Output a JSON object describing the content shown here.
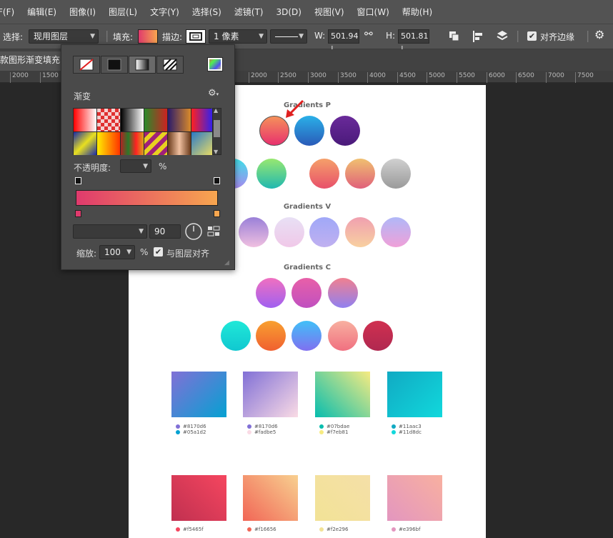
{
  "menubar": {
    "items": [
      "F(F)",
      "编辑(E)",
      "图像(I)",
      "图层(L)",
      "文字(Y)",
      "选择(S)",
      "滤镜(T)",
      "3D(D)",
      "视图(V)",
      "窗口(W)",
      "帮助(H)"
    ]
  },
  "options": {
    "select_label": "选择:",
    "select_value": "现用图层",
    "fill_label": "填充:",
    "stroke_label": "描边:",
    "stroke_width": "1 像素",
    "w_label": "W:",
    "w_value": "501.94 |",
    "h_label": "H:",
    "h_value": "501.81 |",
    "align_edges_label": "对齐边缘"
  },
  "tab": {
    "title": "款图形渐变填充"
  },
  "ruler": {
    "marks": [
      "2000",
      "1500",
      "2000",
      "2500",
      "3000",
      "3500",
      "4000",
      "4500",
      "5000",
      "5500",
      "6000",
      "6500",
      "7000",
      "7500"
    ]
  },
  "panel": {
    "gradient_label": "渐变",
    "opacity_label": "不透明度:",
    "opacity_unit": "%",
    "angle_value": "90",
    "scale_label": "缩放:",
    "scale_value": "100",
    "scale_unit": "%",
    "align_layer_label": "与图层对齐",
    "swatches": [
      "linear-gradient(90deg,#ff0000,#ffffff)",
      "repeating-conic-gradient(#e03030 0 25%,#f5d0d0 0 50%) 0 0/10px 10px",
      "linear-gradient(90deg,#000000,#ffffff)",
      "linear-gradient(90deg,#2a8a2a,#cc2222)",
      "linear-gradient(90deg,#2a1a6a,#d98a2a)",
      "linear-gradient(90deg,#ff2020,#2020ff)",
      "linear-gradient(135deg,#1a2aa8,#e8e020,#1a2aa8)",
      "linear-gradient(90deg,#ffee00,#ff3300)",
      "linear-gradient(90deg,#b22222,#2a7a2a,#ff2222,#d8a020)",
      "repeating-linear-gradient(135deg,#a0207a 0 6px,#e8d020 6px 12px)",
      "linear-gradient(90deg,#6a3a1a,#f0c0a0,#6a3a1a)",
      "linear-gradient(135deg,#2a7ac8,#f0e060)"
    ],
    "gradient_colors": [
      "#e03a6d",
      "#f7a64f"
    ]
  },
  "artboard": {
    "section_p": "Gradients P",
    "section_v": "Gradients V",
    "section_c": "Gradients C",
    "circles_p1": [
      "linear-gradient(180deg,#f5915a,#e8306e)",
      "linear-gradient(180deg,#2ab0e8,#2a5ab8)",
      "linear-gradient(180deg,#6a2a9a,#4a1a7a)"
    ],
    "circles_p2": [
      "linear-gradient(180deg,#40e0e8,#a88af0)",
      "linear-gradient(180deg,#98e870,#20b8b0)",
      "linear-gradient(180deg,#f5a06a,#e8506a)",
      "linear-gradient(180deg,#f0c070,#e0607a)",
      "linear-gradient(180deg,#d0d0d0,#9a9a9a)"
    ],
    "circles_v": [
      "linear-gradient(180deg,#9a80d8,#f0c0e0)",
      "linear-gradient(180deg,#e8e0f5,#f0c8e8)",
      "linear-gradient(180deg,#a0a8f8,#c0b0f0)",
      "linear-gradient(180deg,#f0a0b0,#f8d0a0)",
      "linear-gradient(180deg,#b0b8f8,#f0a0d8)"
    ],
    "circles_c1": [
      "linear-gradient(180deg,#f070c0,#a060f0)",
      "linear-gradient(180deg,#e860a8,#c050c0)",
      "linear-gradient(180deg,#f08090,#9080f0)"
    ],
    "circles_c2": [
      "linear-gradient(180deg,#20e8d8,#10c8d0)",
      "linear-gradient(180deg,#f8a030,#f06030)",
      "linear-gradient(180deg,#40c0f8,#8070f0)",
      "linear-gradient(180deg,#f8b0a0,#f07080)",
      "linear-gradient(180deg,#d03050,#b02850)"
    ],
    "squares_row1": [
      {
        "grad": "linear-gradient(135deg,#8170d6,#05a1d2)",
        "c1": "#8170d6",
        "t1": "#8170d6",
        "c2": "#05a1d2",
        "t2": "#05a1d2"
      },
      {
        "grad": "linear-gradient(135deg,#8170d6,#fadbe5)",
        "c1": "#8170d6",
        "t1": "#8170d6",
        "c2": "#fadbe5",
        "t2": "#fadbe5"
      },
      {
        "grad": "linear-gradient(45deg,#07bdae,#f7eb81)",
        "c1": "#07bdae",
        "t1": "#07bdae",
        "c2": "#f7eb81",
        "t2": "#f7eb81"
      },
      {
        "grad": "linear-gradient(135deg,#11aac3,#11d8dc)",
        "c1": "#11aac3",
        "t1": "#11aac3",
        "c2": "#11d8dc",
        "t2": "#11d8dc"
      }
    ],
    "squares_row2": [
      {
        "grad": "linear-gradient(45deg,#c03050,#f5465f)",
        "c1": "#f5465f",
        "t1": "#f5465f"
      },
      {
        "grad": "linear-gradient(45deg,#f16656,#f8d090)",
        "c1": "#f16656",
        "t1": "#f16656"
      },
      {
        "grad": "linear-gradient(45deg,#f2e296,#f5e0a8)",
        "c1": "#f2e296",
        "t1": "#f2e296"
      },
      {
        "grad": "linear-gradient(45deg,#e396bf,#f8b0a0)",
        "c1": "#e396bf",
        "t1": "#e396bf"
      }
    ]
  }
}
